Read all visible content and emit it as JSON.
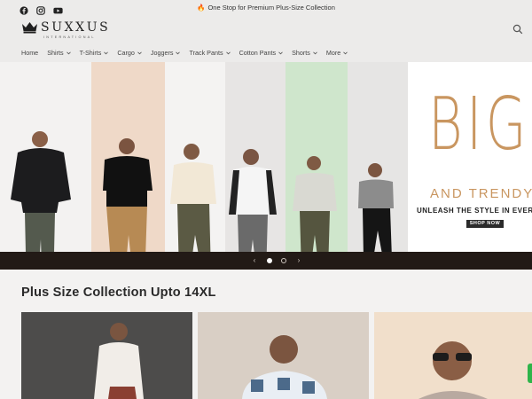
{
  "announcement": {
    "text": "One Stop for Premium Plus-Size Collection",
    "icon": "fire-icon"
  },
  "social": [
    "facebook-icon",
    "instagram-icon",
    "youtube-icon"
  ],
  "brand": {
    "name": "SUXXUS",
    "tagline": "INTERNATIONAL",
    "logo_icon": "crown-icon"
  },
  "header": {
    "search_icon": "search-icon"
  },
  "nav": {
    "items": [
      {
        "label": "Home",
        "dropdown": false
      },
      {
        "label": "Shirts",
        "dropdown": true
      },
      {
        "label": "T-Shirts",
        "dropdown": true
      },
      {
        "label": "Cargo",
        "dropdown": true
      },
      {
        "label": "Joggers",
        "dropdown": true
      },
      {
        "label": "Track Pants",
        "dropdown": true
      },
      {
        "label": "Cotton Pants",
        "dropdown": true
      },
      {
        "label": "Shorts",
        "dropdown": true
      },
      {
        "label": "More",
        "dropdown": true
      }
    ]
  },
  "hero": {
    "headline": "BIG",
    "subline": "AND TRENDY",
    "tagline": "UNLEASH THE STYLE IN EVERY",
    "cta": "SHOP NOW",
    "accent_color": "#c99660"
  },
  "slider": {
    "prev": "‹",
    "next": "›",
    "slide_count": 2,
    "active_index": 0
  },
  "collection": {
    "title": "Plus Size Collection Upto 14XL"
  },
  "colors": {
    "top_bar": "#ecebea",
    "slider_bar": "#221a16",
    "section_bg": "#f3f2f1"
  }
}
